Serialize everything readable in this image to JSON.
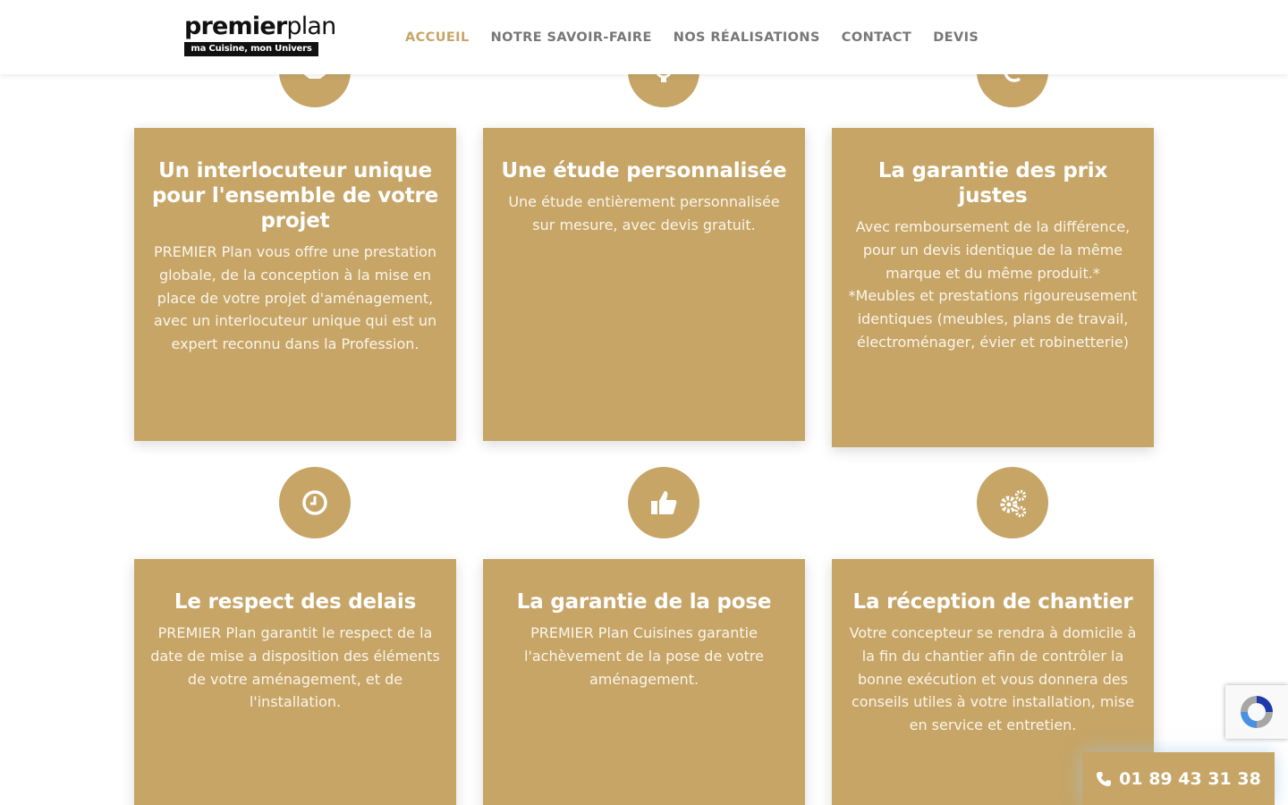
{
  "header": {
    "logo": {
      "brand_regular": "premier",
      "brand_light": "plan",
      "tagline": "ma Cuisine, mon Univers"
    },
    "nav": [
      {
        "label": "ACCUEIL",
        "active": true
      },
      {
        "label": "NOTRE SAVOIR-FAIRE",
        "active": false
      },
      {
        "label": "NOS RÉALISATIONS",
        "active": false
      },
      {
        "label": "CONTACT",
        "active": false
      },
      {
        "label": "DEVIS",
        "active": false
      }
    ]
  },
  "features": [
    {
      "icon": "handshake-icon",
      "title": "Un interlocuteur unique pour l'ensemble de votre projet",
      "text": "PREMIER Plan vous offre une prestation globale, de la conception à la mise en place de votre projet d'aménagement, avec un interlocuteur unique qui est un expert reconnu dans la Profession."
    },
    {
      "icon": "lightbulb-icon",
      "title": "Une étude personnalisée",
      "text": "Une étude entièrement personnalisée sur mesure, avec devis gratuit."
    },
    {
      "icon": "euro-icon",
      "title": "La garantie des prix justes",
      "text": "Avec remboursement de la différence, pour un devis identique de la même marque et du même produit.*\n*Meubles et prestations rigoureusement identiques (meubles, plans de travail, électroménager, évier et robinetterie)"
    },
    {
      "icon": "clock-icon",
      "title": "Le respect des delais",
      "text": "PREMIER Plan garantit le respect de la date de mise a disposition des éléments de votre aménagement, et de l'installation."
    },
    {
      "icon": "thumbs-up-icon",
      "title": "La garantie de la pose",
      "text": "PREMIER Plan Cuisines garantie l'achèvement de la pose de votre aménagement."
    },
    {
      "icon": "gears-icon",
      "title": "La réception de chantier",
      "text": "Votre concepteur se rendra à domicile à la fin du chantier afin de contrôler la bonne exécution et vous donnera des conseils utiles à votre installation, mise en service et entretien."
    }
  ],
  "phone_button": {
    "icon": "phone-icon",
    "label": "01 89 43 31 38"
  },
  "recaptcha": {
    "icon": "recaptcha-icon"
  },
  "colors": {
    "accent": "#c6a567",
    "nav_text": "#777777",
    "white": "#ffffff"
  }
}
